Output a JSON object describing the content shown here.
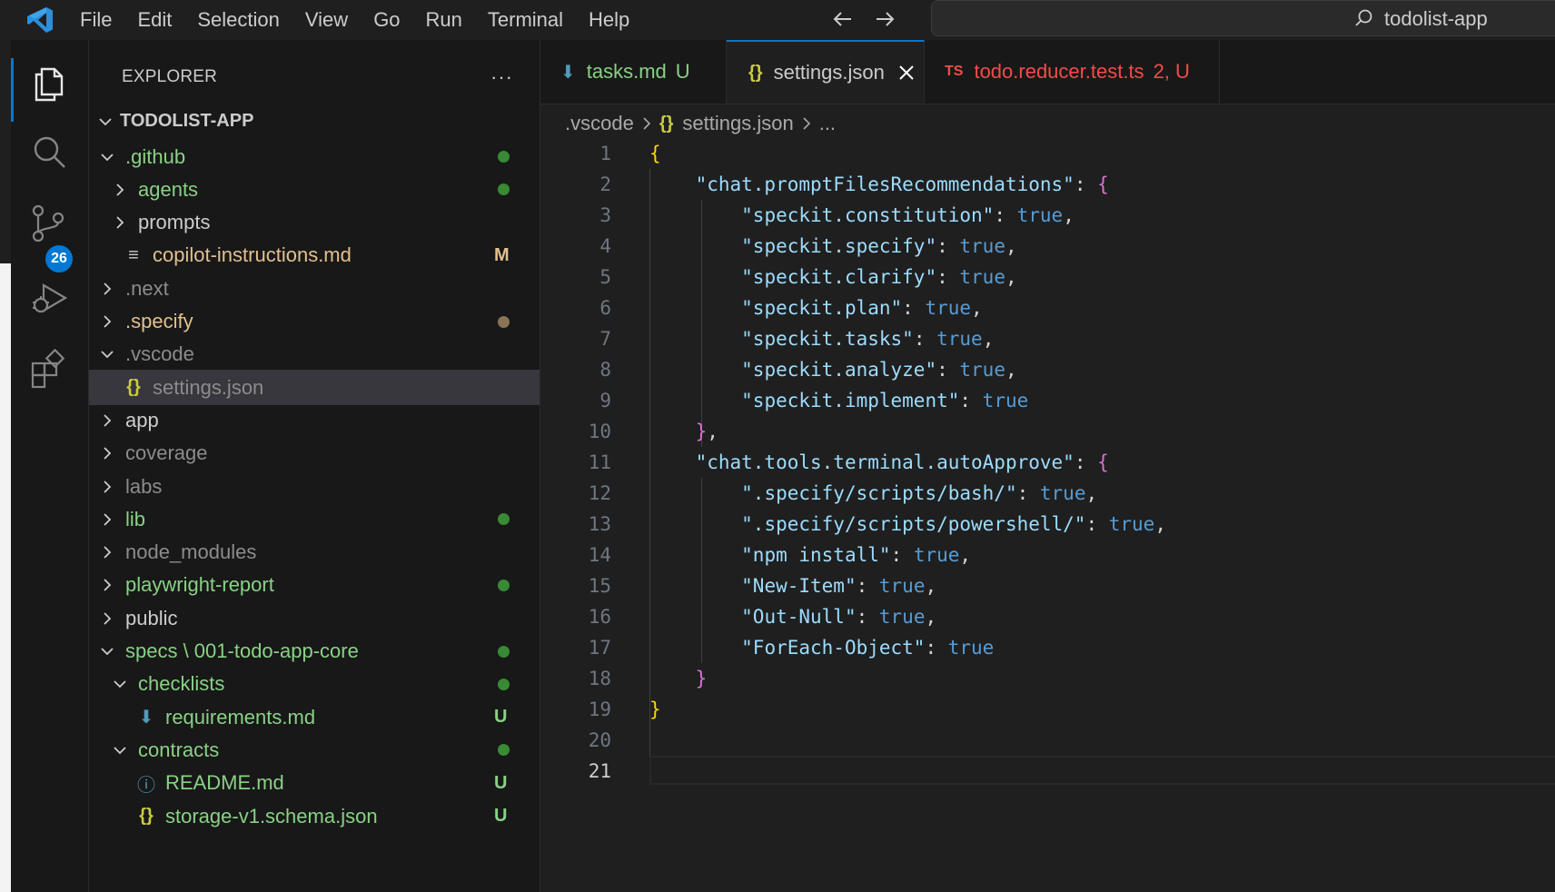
{
  "menu": [
    "File",
    "Edit",
    "Selection",
    "View",
    "Go",
    "Run",
    "Terminal",
    "Help"
  ],
  "search": {
    "text": "todolist-app"
  },
  "activity": {
    "scm_badge": "26"
  },
  "explorer": {
    "title": "EXPLORER",
    "more": "···",
    "root": "TODOLIST-APP",
    "items": [
      {
        "label": ".github",
        "indent": 1,
        "kind": "folder-open",
        "color": "#89d185",
        "dot": "#388a34"
      },
      {
        "label": "agents",
        "indent": 2,
        "kind": "folder",
        "color": "#89d185",
        "dot": "#388a34"
      },
      {
        "label": "prompts",
        "indent": 2,
        "kind": "folder",
        "color": "#cccccc"
      },
      {
        "label": "copilot-instructions.md",
        "indent": 2,
        "kind": "file-lines",
        "color": "#e2c08d",
        "status": "M",
        "status_color": "#e2c08d"
      },
      {
        "label": ".next",
        "indent": 1,
        "kind": "folder",
        "color": "#8c8c8c"
      },
      {
        "label": ".specify",
        "indent": 1,
        "kind": "folder",
        "color": "#e2c08d",
        "dot": "#8b7355"
      },
      {
        "label": ".vscode",
        "indent": 1,
        "kind": "folder-open",
        "color": "#8c8c8c"
      },
      {
        "label": "settings.json",
        "indent": 2,
        "kind": "json",
        "color": "#8c8c8c",
        "selected": true
      },
      {
        "label": "app",
        "indent": 1,
        "kind": "folder",
        "color": "#cccccc"
      },
      {
        "label": "coverage",
        "indent": 1,
        "kind": "folder",
        "color": "#8c8c8c"
      },
      {
        "label": "labs",
        "indent": 1,
        "kind": "folder",
        "color": "#8c8c8c"
      },
      {
        "label": "lib",
        "indent": 1,
        "kind": "folder",
        "color": "#89d185",
        "dot": "#388a34"
      },
      {
        "label": "node_modules",
        "indent": 1,
        "kind": "folder",
        "color": "#8c8c8c"
      },
      {
        "label": "playwright-report",
        "indent": 1,
        "kind": "folder",
        "color": "#89d185",
        "dot": "#388a34"
      },
      {
        "label": "public",
        "indent": 1,
        "kind": "folder",
        "color": "#cccccc"
      },
      {
        "label": "specs \\ 001-todo-app-core",
        "indent": 1,
        "kind": "folder-open",
        "color": "#89d185",
        "dot": "#388a34"
      },
      {
        "label": "checklists",
        "indent": 2,
        "kind": "folder-open",
        "color": "#89d185",
        "dot": "#388a34"
      },
      {
        "label": "requirements.md",
        "indent": 3,
        "kind": "md",
        "color": "#89d185",
        "status": "U",
        "status_color": "#89d185"
      },
      {
        "label": "contracts",
        "indent": 2,
        "kind": "folder-open",
        "color": "#89d185",
        "dot": "#388a34"
      },
      {
        "label": "README.md",
        "indent": 3,
        "kind": "info",
        "color": "#89d185",
        "status": "U",
        "status_color": "#89d185"
      },
      {
        "label": "storage-v1.schema.json",
        "indent": 3,
        "kind": "json",
        "color": "#89d185",
        "status": "U",
        "status_color": "#89d185"
      }
    ]
  },
  "tabs": [
    {
      "label": "tasks.md",
      "status": "U",
      "color": "#89d185",
      "status_color": "#89d185",
      "icon": "md"
    },
    {
      "label": "settings.json",
      "status": "",
      "color": "#cccccc",
      "icon": "json",
      "active": true
    },
    {
      "label": "todo.reducer.test.ts",
      "status": "2, U",
      "color": "#f14c4c",
      "status_color": "#f14c4c",
      "icon": "ts"
    }
  ],
  "breadcrumb": [
    ".vscode",
    "settings.json",
    "..."
  ],
  "editor": {
    "current_line": 21,
    "lines": [
      [
        [
          "{",
          "by"
        ]
      ],
      [
        [
          "    ",
          ""
        ],
        [
          "\"chat.promptFilesRecommendations\"",
          "str"
        ],
        [
          ": ",
          ""
        ],
        [
          "{",
          "bp"
        ]
      ],
      [
        [
          "        ",
          ""
        ],
        [
          "\"speckit.constitution\"",
          "str"
        ],
        [
          ": ",
          ""
        ],
        [
          "true",
          "bool"
        ],
        [
          ",",
          ""
        ]
      ],
      [
        [
          "        ",
          ""
        ],
        [
          "\"speckit.specify\"",
          "str"
        ],
        [
          ": ",
          ""
        ],
        [
          "true",
          "bool"
        ],
        [
          ",",
          ""
        ]
      ],
      [
        [
          "        ",
          ""
        ],
        [
          "\"speckit.clarify\"",
          "str"
        ],
        [
          ": ",
          ""
        ],
        [
          "true",
          "bool"
        ],
        [
          ",",
          ""
        ]
      ],
      [
        [
          "        ",
          ""
        ],
        [
          "\"speckit.plan\"",
          "str"
        ],
        [
          ": ",
          ""
        ],
        [
          "true",
          "bool"
        ],
        [
          ",",
          ""
        ]
      ],
      [
        [
          "        ",
          ""
        ],
        [
          "\"speckit.tasks\"",
          "str"
        ],
        [
          ": ",
          ""
        ],
        [
          "true",
          "bool"
        ],
        [
          ",",
          ""
        ]
      ],
      [
        [
          "        ",
          ""
        ],
        [
          "\"speckit.analyze\"",
          "str"
        ],
        [
          ": ",
          ""
        ],
        [
          "true",
          "bool"
        ],
        [
          ",",
          ""
        ]
      ],
      [
        [
          "        ",
          ""
        ],
        [
          "\"speckit.implement\"",
          "str"
        ],
        [
          ": ",
          ""
        ],
        [
          "true",
          "bool"
        ]
      ],
      [
        [
          "    ",
          ""
        ],
        [
          "}",
          "bp"
        ],
        [
          ",",
          ""
        ]
      ],
      [
        [
          "    ",
          ""
        ],
        [
          "\"chat.tools.terminal.autoApprove\"",
          "str"
        ],
        [
          ": ",
          ""
        ],
        [
          "{",
          "bp"
        ]
      ],
      [
        [
          "        ",
          ""
        ],
        [
          "\".specify/scripts/bash/\"",
          "str"
        ],
        [
          ": ",
          ""
        ],
        [
          "true",
          "bool"
        ],
        [
          ",",
          ""
        ]
      ],
      [
        [
          "        ",
          ""
        ],
        [
          "\".specify/scripts/powershell/\"",
          "str"
        ],
        [
          ": ",
          ""
        ],
        [
          "true",
          "bool"
        ],
        [
          ",",
          ""
        ]
      ],
      [
        [
          "        ",
          ""
        ],
        [
          "\"npm install\"",
          "str"
        ],
        [
          ": ",
          ""
        ],
        [
          "true",
          "bool"
        ],
        [
          ",",
          ""
        ]
      ],
      [
        [
          "        ",
          ""
        ],
        [
          "\"New-Item\"",
          "str"
        ],
        [
          ": ",
          ""
        ],
        [
          "true",
          "bool"
        ],
        [
          ",",
          ""
        ]
      ],
      [
        [
          "        ",
          ""
        ],
        [
          "\"Out-Null\"",
          "str"
        ],
        [
          ": ",
          ""
        ],
        [
          "true",
          "bool"
        ],
        [
          ",",
          ""
        ]
      ],
      [
        [
          "        ",
          ""
        ],
        [
          "\"ForEach-Object\"",
          "str"
        ],
        [
          ": ",
          ""
        ],
        [
          "true",
          "bool"
        ]
      ],
      [
        [
          "    ",
          ""
        ],
        [
          "}",
          "bp"
        ]
      ],
      [
        [
          "}",
          "by"
        ]
      ],
      [],
      []
    ]
  }
}
